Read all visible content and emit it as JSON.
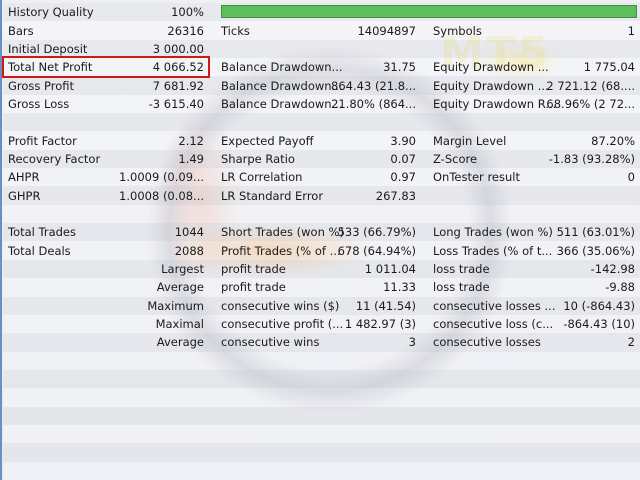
{
  "history_quality": {
    "label": "History Quality",
    "value": "100%",
    "progress_percent": 100
  },
  "rows": [
    {
      "l1": "Bars",
      "v1": "26316",
      "l2": "Ticks",
      "v2": "14094897",
      "l3": "Symbols",
      "v3": "1"
    },
    {
      "l1": "Initial Deposit",
      "v1": "3 000.00",
      "l2": "",
      "v2": "",
      "l3": "",
      "v3": ""
    },
    {
      "l1": "Total Net Profit",
      "v1": "4 066.52",
      "l2": "Balance Drawdown...",
      "v2": "31.75",
      "l3": "Equity Drawdown ...",
      "v3": "1 775.04"
    },
    {
      "l1": "Gross Profit",
      "v1": "7 681.92",
      "l2": "Balance Drawdown...",
      "v2": "864.43 (21.8...",
      "l3": "Equity Drawdown ...",
      "v3": "2 721.12 (68...."
    },
    {
      "l1": "Gross Loss",
      "v1": "-3 615.40",
      "l2": "Balance Drawdown...",
      "v2": "21.80% (864...",
      "l3": "Equity Drawdown R...",
      "v3": "68.96% (2 72..."
    },
    {
      "l1": "",
      "v1": "",
      "l2": "",
      "v2": "",
      "l3": "",
      "v3": ""
    },
    {
      "l1": "Profit Factor",
      "v1": "2.12",
      "l2": "Expected Payoff",
      "v2": "3.90",
      "l3": "Margin Level",
      "v3": "87.20%"
    },
    {
      "l1": "Recovery Factor",
      "v1": "1.49",
      "l2": "Sharpe Ratio",
      "v2": "0.07",
      "l3": "Z-Score",
      "v3": "-1.83 (93.28%)"
    },
    {
      "l1": "AHPR",
      "v1": "1.0009 (0.09...",
      "l2": "LR Correlation",
      "v2": "0.97",
      "l3": "OnTester result",
      "v3": "0"
    },
    {
      "l1": "GHPR",
      "v1": "1.0008 (0.08...",
      "l2": "LR Standard Error",
      "v2": "267.83",
      "l3": "",
      "v3": ""
    },
    {
      "l1": "",
      "v1": "",
      "l2": "",
      "v2": "",
      "l3": "",
      "v3": ""
    },
    {
      "l1": "Total Trades",
      "v1": "1044",
      "l2": "Short Trades (won %)",
      "v2": "533 (66.79%)",
      "l3": "Long Trades (won %)",
      "v3": "511 (63.01%)"
    },
    {
      "l1": "Total Deals",
      "v1": "2088",
      "l2": "Profit Trades (% of ...",
      "v2": "678 (64.94%)",
      "l3": "Loss Trades (% of t...",
      "v3": "366 (35.06%)"
    },
    {
      "l1": "",
      "v1": "Largest",
      "l2": "profit trade",
      "v2": "1 011.04",
      "l3": "loss trade",
      "v3": "-142.98"
    },
    {
      "l1": "",
      "v1": "Average",
      "l2": "profit trade",
      "v2": "11.33",
      "l3": "loss trade",
      "v3": "-9.88"
    },
    {
      "l1": "",
      "v1": "Maximum",
      "l2": "consecutive wins ($)",
      "v2": "11 (41.54)",
      "l3": "consecutive losses ...",
      "v3": "10 (-864.43)"
    },
    {
      "l1": "",
      "v1": "Maximal",
      "l2": "consecutive profit (...",
      "v2": "1 482.97 (3)",
      "l3": "consecutive loss (c...",
      "v3": "-864.43 (10)"
    },
    {
      "l1": "",
      "v1": "Average",
      "l2": "consecutive wins",
      "v2": "3",
      "l3": "consecutive losses",
      "v3": "2"
    }
  ],
  "colors": {
    "progress": "#5cbf5c",
    "highlight": "#d01818"
  },
  "watermark": "MT5"
}
